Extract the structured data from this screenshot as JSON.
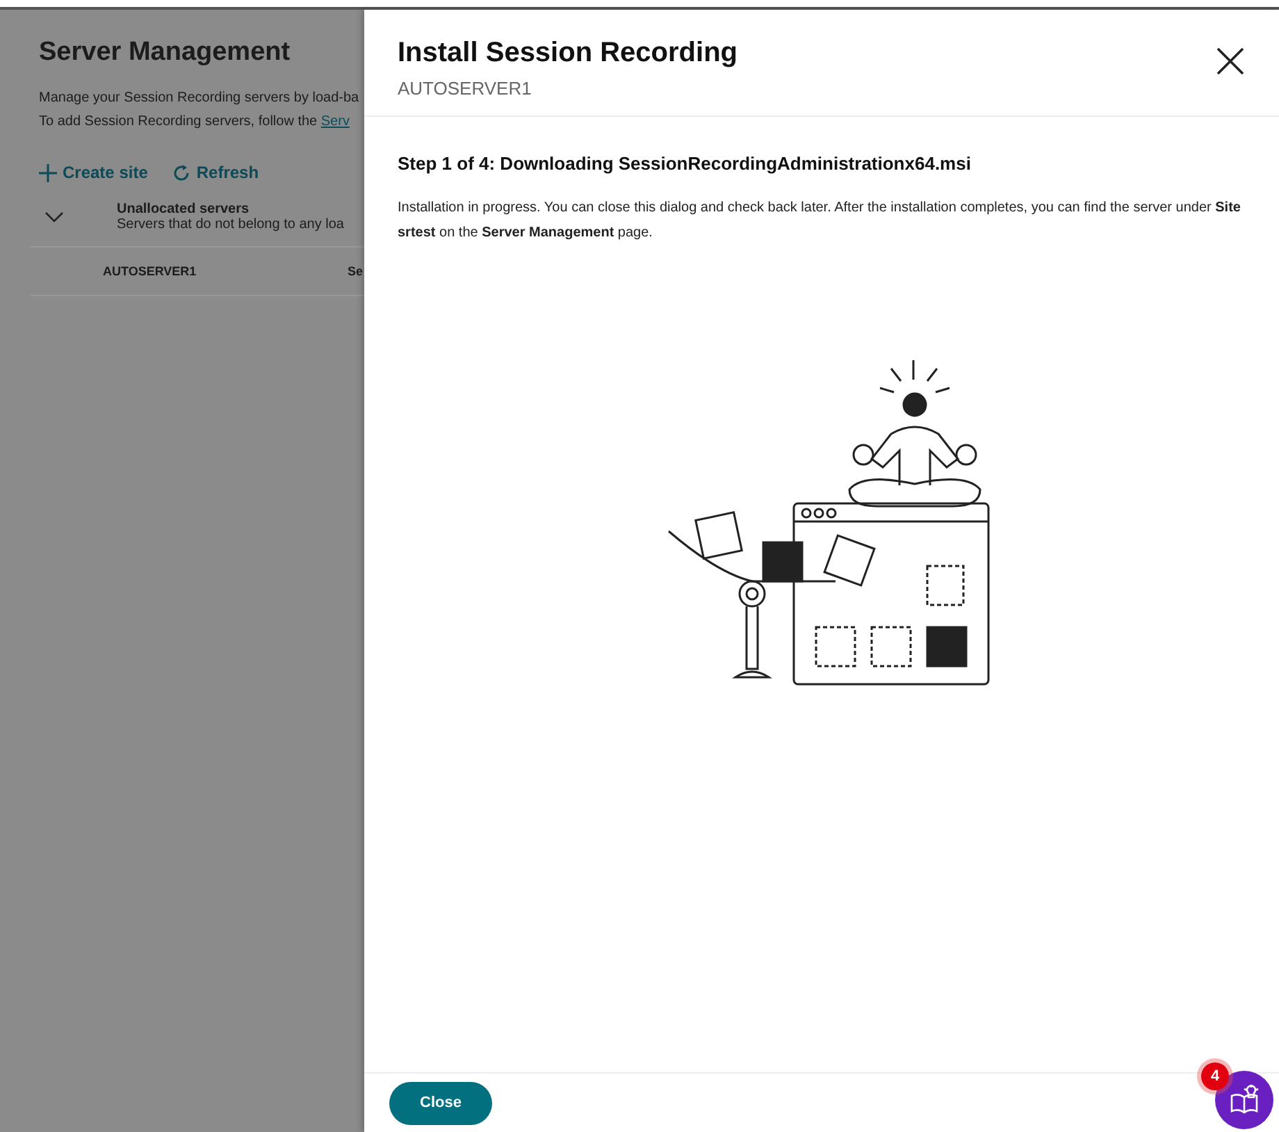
{
  "background_page": {
    "title": "Server Management",
    "description_lines": [
      "Manage your Session Recording servers by load-ba",
      "To add Session Recording servers, follow the "
    ],
    "description_link": "Serv",
    "actions": [
      {
        "kind": "add",
        "label": "Create site"
      },
      {
        "kind": "refresh",
        "label": "Refresh"
      }
    ],
    "group": {
      "expanded": true,
      "title": "Unallocated servers",
      "subtitle": "Servers that do not belong to any loa"
    },
    "rows": [
      {
        "column_1": "AUTOSERVER1",
        "column_2": "Se"
      }
    ]
  },
  "drawer": {
    "title": "Install Session Recording",
    "subtitle": "AUTOSERVER1",
    "step": "Step 1 of 4: Downloading SessionRecordingAdministrationx64.msi",
    "message": "Installation in progress. You can close this dialog and check back later. After the installation completes, you can find the server under **Site srtest** on the **Server Management** page.",
    "close_button": "Close"
  },
  "help_button": {
    "badge": "4"
  }
}
